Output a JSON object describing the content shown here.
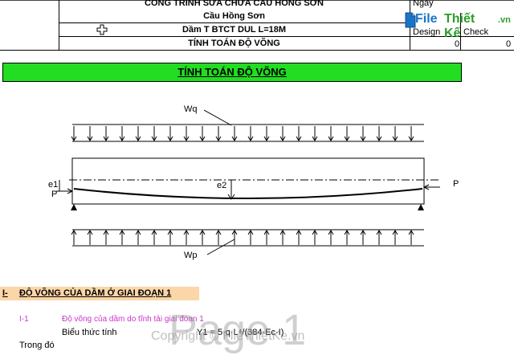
{
  "header": {
    "project": "CÔNG TRÌNH SỬA CHỮA CẦU HỒNG SƠN",
    "bridge": "Cầu Hồng Sơn",
    "beam": "Dầm T BTCT DUL L=18M",
    "calc": "TÍNH TOÁN ĐỘ VÕNG",
    "date_label": "Ngày",
    "design_label": "Design",
    "check_label": "Check",
    "design_value": "0",
    "check_value": "0"
  },
  "logo": {
    "file": "File",
    "thietke": "Thiết Kế",
    "vn": ".vn"
  },
  "banner": {
    "title": "TÍNH TOÁN ĐỘ VÕNG"
  },
  "diagram": {
    "wq": "Wq",
    "wp": "Wp",
    "p_left": "P",
    "p_right": "P",
    "e1": "e1",
    "e2": "e2"
  },
  "section": {
    "number": "I-",
    "title": "ĐỘ VÕNG CỦA DẦM Ở GIAI ĐOẠN 1"
  },
  "sub": {
    "number": "I-1",
    "title": "Độ võng của dầm do tĩnh tải giai đoạn 1",
    "expr_label": "Biểu thức tính",
    "expr": "Y1 = 5·q·L⁴/(384·Ec·I)",
    "where": "Trong đó"
  },
  "watermark": {
    "page": "Page 1",
    "copyright": "Copyright © FileThietKe.vn"
  },
  "colors": {
    "banner": "#22dd22",
    "section_bg": "#fbd6a8",
    "sub_text": "#cc33cc",
    "logo_blue": "#1a73c8",
    "logo_green": "#2a9d2a"
  }
}
